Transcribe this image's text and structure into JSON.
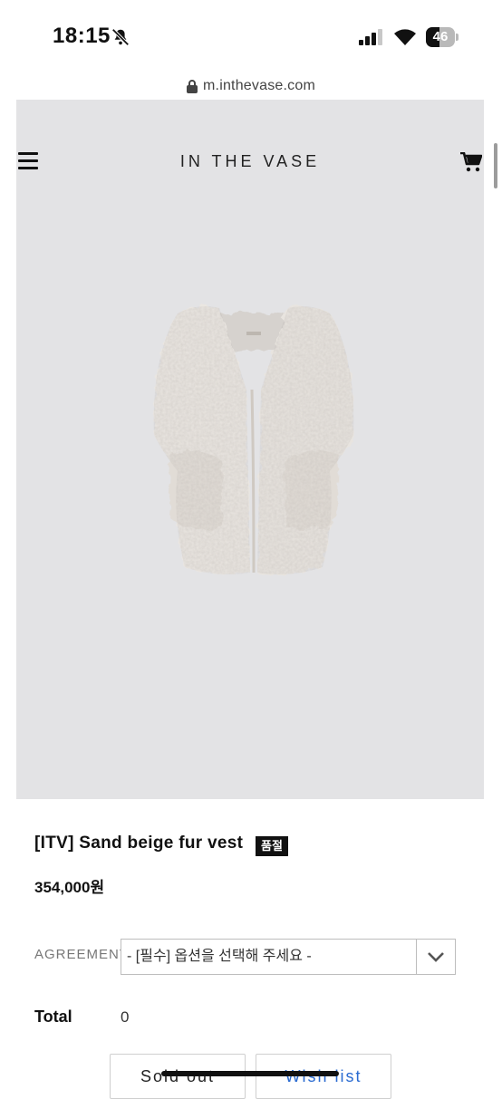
{
  "status_bar": {
    "time": "18:15",
    "battery": "46",
    "battery_level": 0.46
  },
  "browser": {
    "url": "m.inthevase.com"
  },
  "header": {
    "brand": "IN THE VASE"
  },
  "product": {
    "name": "[ITV] Sand beige fur vest",
    "badge": "품절",
    "price": "354,000원"
  },
  "option": {
    "label": "AGREEMENT",
    "selected": "- [필수] 옵션을 선택해 주세요 -"
  },
  "total": {
    "label": "Total",
    "value": "0"
  },
  "buttons": {
    "soldout": "Sold out",
    "wishlist": "Wish list"
  },
  "colors": {
    "hero_bg": "#e3e3e5",
    "badge_bg": "#111111",
    "wishlist_text": "#2a6bd1"
  }
}
